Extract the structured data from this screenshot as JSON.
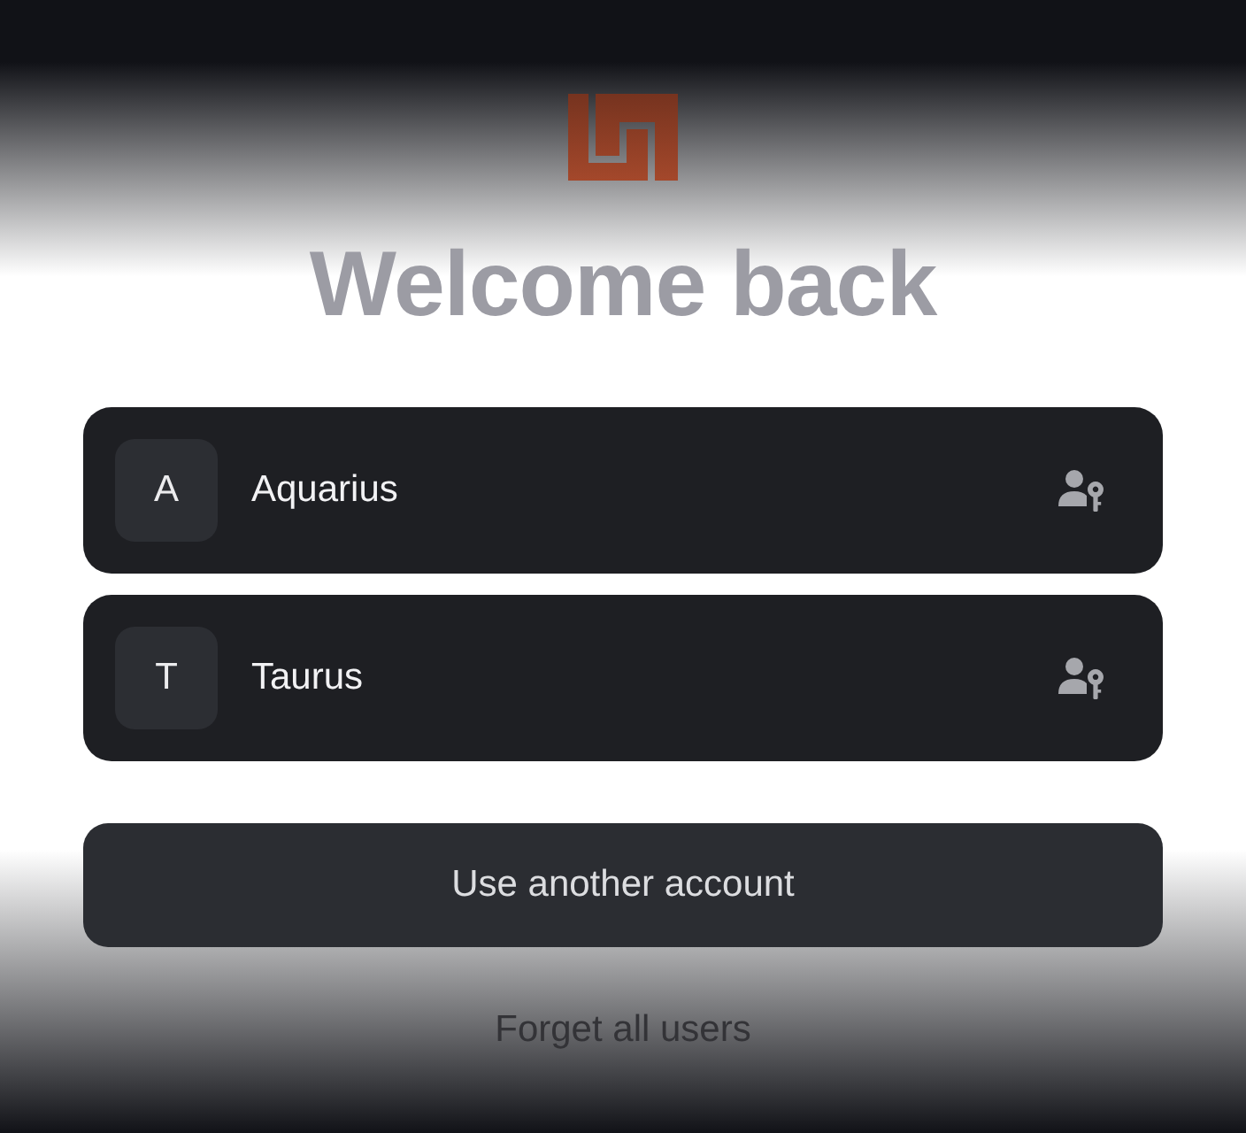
{
  "title": "Welcome back",
  "accounts": [
    {
      "initial": "A",
      "name": "Aquarius"
    },
    {
      "initial": "T",
      "name": "Taurus"
    }
  ],
  "primary_button": "Use another account",
  "link": "Forget all users"
}
